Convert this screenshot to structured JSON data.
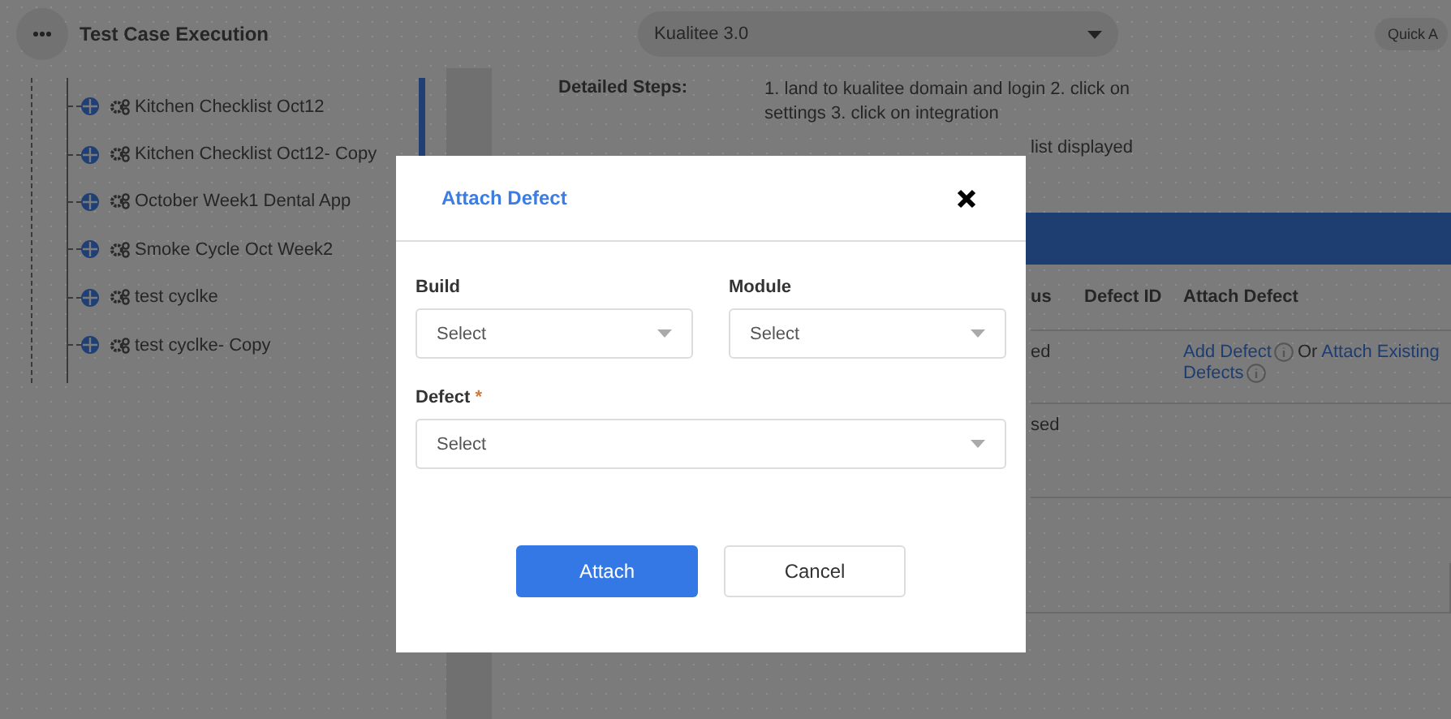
{
  "header": {
    "title": "Test Case Execution",
    "project": "Kualitee 3.0",
    "quick_action": "Quick A"
  },
  "tree": {
    "items": [
      {
        "label": "Kitchen Checklist Oct12"
      },
      {
        "label": "Kitchen Checklist Oct12- Copy"
      },
      {
        "label": "October Week1 Dental App"
      },
      {
        "label": "Smoke Cycle Oct Week2"
      },
      {
        "label": "test cyclke"
      },
      {
        "label": "test cyclke- Copy"
      }
    ]
  },
  "details": {
    "label": "Detailed Steps:",
    "value": "1. land to kualitee domain and login 2. click on settings 3. click on integration",
    "expected_visible": "list displayed"
  },
  "table": {
    "columns": [
      "us",
      "Defect ID",
      "Attach Defect"
    ],
    "rows": [
      {
        "status": "ed",
        "add_link": "Add Defect",
        "or_text": "Or",
        "attach_link": "Attach Existing",
        "attach_link_cont": "Defects"
      },
      {
        "status": "sed"
      }
    ]
  },
  "modal": {
    "title": "Attach Defect",
    "fields": [
      {
        "label": "Build",
        "placeholder": "Select"
      },
      {
        "label": "Module",
        "placeholder": "Select"
      },
      {
        "label": "Defect",
        "mark": "*",
        "placeholder": "Select"
      }
    ],
    "buttons": [
      {
        "label": "Attach",
        "kind": "primary"
      },
      {
        "label": "Cancel",
        "kind": "secondary"
      }
    ]
  }
}
